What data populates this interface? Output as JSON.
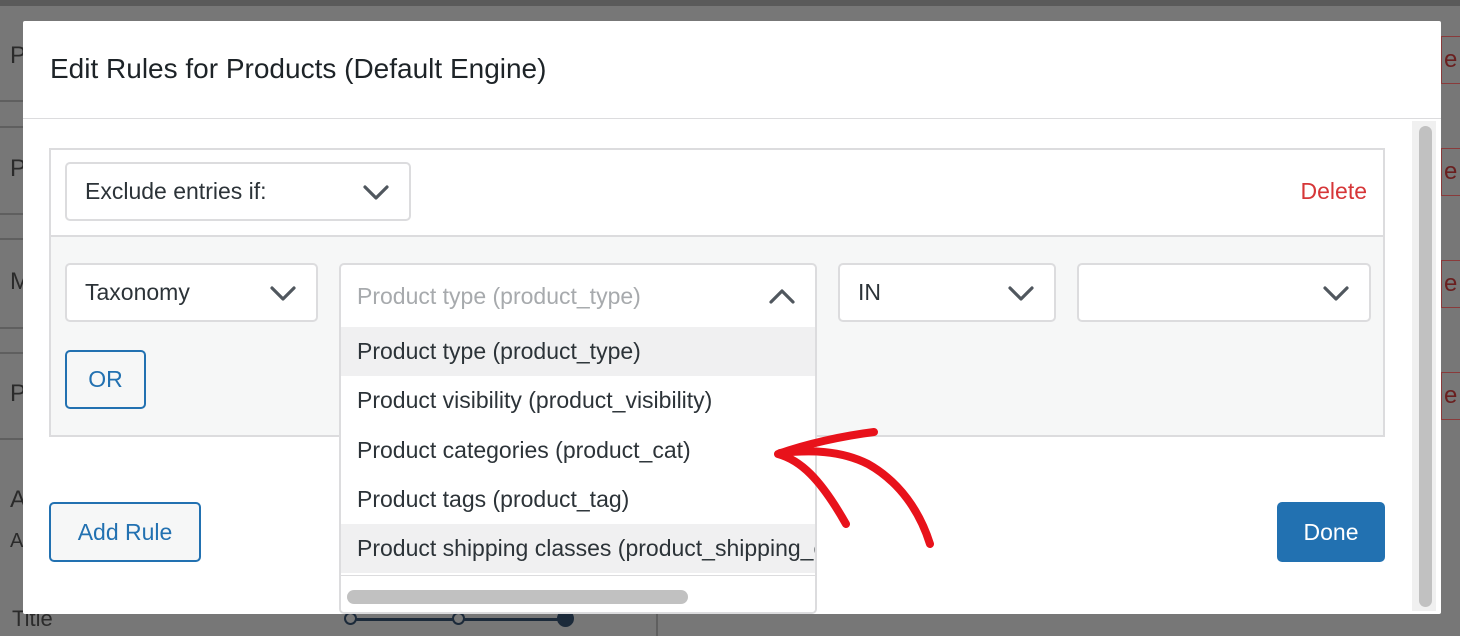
{
  "modal": {
    "title": "Edit Rules for Products (Default Engine)"
  },
  "rule": {
    "mode_select": "Exclude entries if:",
    "delete_label": "Delete",
    "source_select": "Taxonomy",
    "taxonomy_placeholder": "Product type (product_type)",
    "operator_select": "IN",
    "value_select": "",
    "or_label": "OR"
  },
  "dropdown": {
    "options": [
      "Product type (product_type)",
      "Product visibility (product_visibility)",
      "Product categories (product_cat)",
      "Product tags (product_tag)",
      "Product shipping classes (product_shipping_class)"
    ]
  },
  "footer": {
    "add_rule_label": "Add Rule",
    "done_label": "Done"
  },
  "background": {
    "letters": [
      "P",
      "P",
      "M",
      "P",
      "A",
      "A"
    ],
    "right_letters": [
      "e",
      "e",
      "e",
      "e"
    ],
    "title": "Title"
  },
  "colors": {
    "accent": "#2271b1",
    "danger": "#d63638",
    "annotation_arrow": "#e8121b"
  },
  "icons": {
    "chevron_down": "chevron-down-icon",
    "chevron_up": "chevron-up-icon",
    "annotation": "arrow-annotation-icon"
  }
}
